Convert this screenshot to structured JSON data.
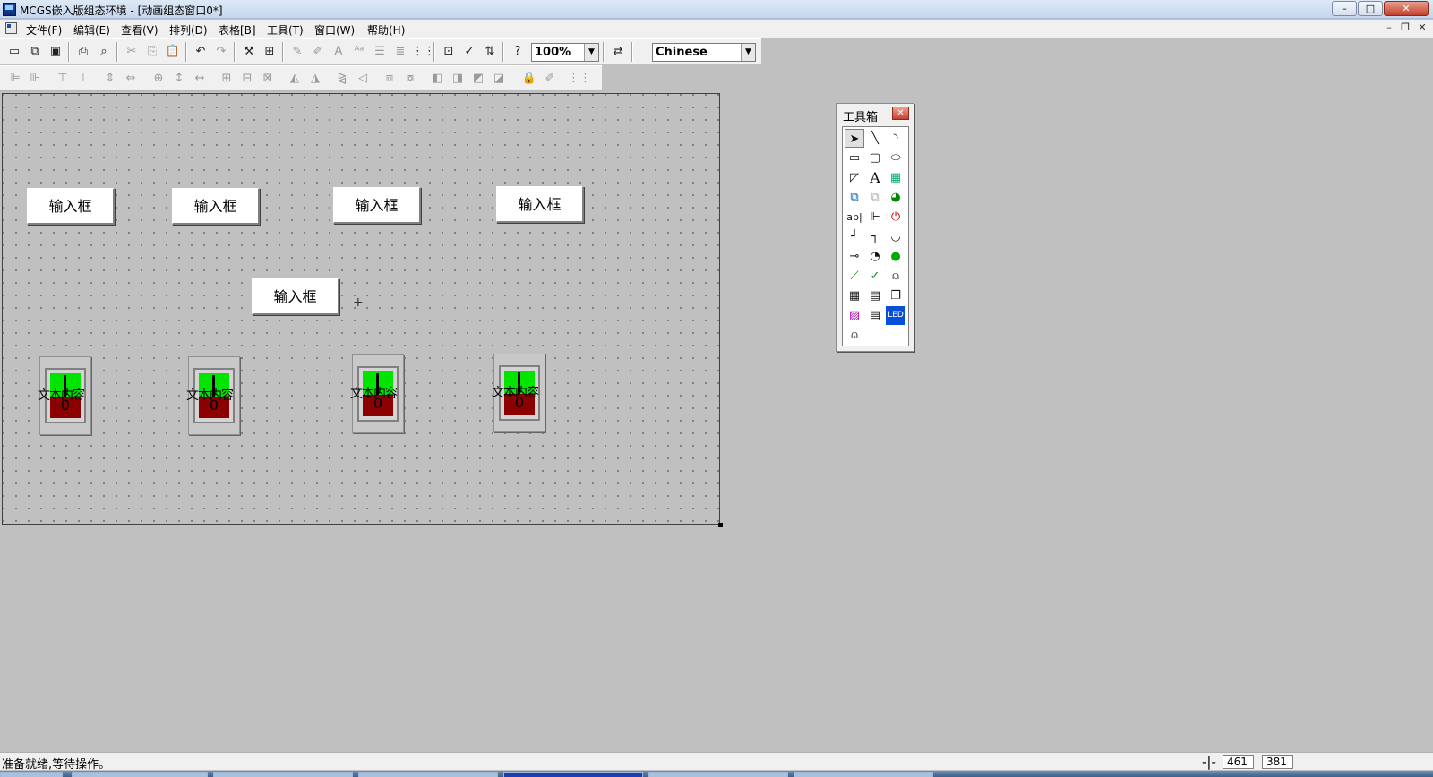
{
  "window": {
    "title": "MCGS嵌入版组态环境 - [动画组态窗口0*]",
    "minimize": "–",
    "maximize": "□",
    "close": "✕"
  },
  "menu": {
    "items": [
      "文件(F)",
      "编辑(E)",
      "查看(V)",
      "排列(D)",
      "表格[B]",
      "工具(T)",
      "窗口(W)",
      "帮助(H)"
    ],
    "mdi_minimize": "–",
    "mdi_restore": "❐",
    "mdi_close": "✕"
  },
  "toolbar": {
    "zoom": "100%",
    "language": "Chinese",
    "dropdown_arrow": "▼"
  },
  "canvas": {
    "input_box_label": "输入框",
    "input_boxes": [
      "输入框",
      "输入框",
      "输入框",
      "输入框",
      "输入框"
    ],
    "cursor": "+",
    "switch_text": "文本内容",
    "switch_value": "0",
    "switches": [
      {
        "text": "文本内容",
        "value": "0"
      },
      {
        "text": "文本内容",
        "value": "0"
      },
      {
        "text": "文本内容",
        "value": "0"
      },
      {
        "text": "文本内容",
        "value": "0"
      }
    ]
  },
  "toolbox": {
    "title": "工具箱",
    "close": "✕",
    "tool_text_label": "A",
    "tool_input_label": "ab|",
    "tool_led_label": "LED"
  },
  "status": {
    "text": "准备就绪,等待操作。",
    "cursor_symbol": "-|-",
    "x": "461",
    "y": "381"
  },
  "colors": {
    "switch_on": "#00e400",
    "switch_off": "#8b0000",
    "workspace": "#c0c0c0"
  }
}
